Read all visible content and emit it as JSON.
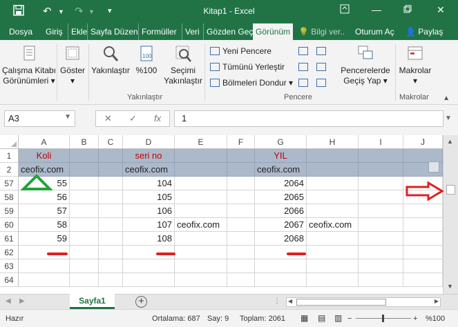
{
  "window": {
    "title": "Kitap1 - Excel",
    "accent": "#217346"
  },
  "tabs": [
    "Dosya",
    "Giriş",
    "Ekle",
    "Sayfa Düzen",
    "Formüller",
    "Veri",
    "Gözden Geç",
    "Görünüm",
    "Bilgi ver..",
    "Oturum Aç",
    "Paylaş"
  ],
  "ribbon": {
    "calisma_kitabi": "Çalışma Kitabı",
    "gorunumleri": "Görünümleri",
    "goster": "Göster",
    "yakinlastir": "Yakınlaştır",
    "yuzde100": "%100",
    "secimi": "Seçimi",
    "secimi2": "Yakınlaştır",
    "yeni_pencere": "Yeni Pencere",
    "tumunu": "Tümünü Yerleştir",
    "bolmeleri": "Bölmeleri Dondur",
    "pencerelerde": "Pencerelerde",
    "gecis_yap": "Geçiş Yap",
    "makrolar": "Makrolar",
    "grp_yakin": "Yakınlaştır",
    "grp_pencere": "Pencere",
    "grp_makro": "Makrolar"
  },
  "formula_bar": {
    "name_box": "A3",
    "cancel": "✕",
    "enter": "✓",
    "fx": "fx",
    "value": "1"
  },
  "columns": [
    "A",
    "B",
    "C",
    "D",
    "E",
    "F",
    "G",
    "H",
    "I",
    "J"
  ],
  "row_numbers": [
    "1",
    "2",
    "57",
    "58",
    "59",
    "60",
    "61",
    "62",
    "63",
    "64"
  ],
  "cells": {
    "r1": {
      "A": "Koli",
      "D": "seri no",
      "G": "YIL"
    },
    "r2": {
      "A": "ceofix.com",
      "D": "ceofix.com",
      "G": "ceofix.com"
    },
    "r57": {
      "A": "55",
      "D": "104",
      "G": "2064"
    },
    "r58": {
      "A": "56",
      "D": "105",
      "G": "2065"
    },
    "r59": {
      "A": "57",
      "D": "106",
      "G": "2066"
    },
    "r60": {
      "A": "58",
      "D": "107",
      "E": "ceofix.com",
      "G": "2067",
      "H": "ceofix.com"
    },
    "r61": {
      "A": "59",
      "D": "108",
      "G": "2068"
    }
  },
  "sheet": {
    "name": "Sayfa1",
    "add": "+"
  },
  "status": {
    "ready": "Hazır",
    "average": "Ortalama: 687",
    "count": "Say: 9",
    "sum": "Toplam: 2061",
    "zoom": "%100"
  },
  "colors": {
    "header_fill": "#acb9ca",
    "header_text": "#c00000",
    "annot_green": "#22a33a",
    "annot_red": "#e02020"
  }
}
